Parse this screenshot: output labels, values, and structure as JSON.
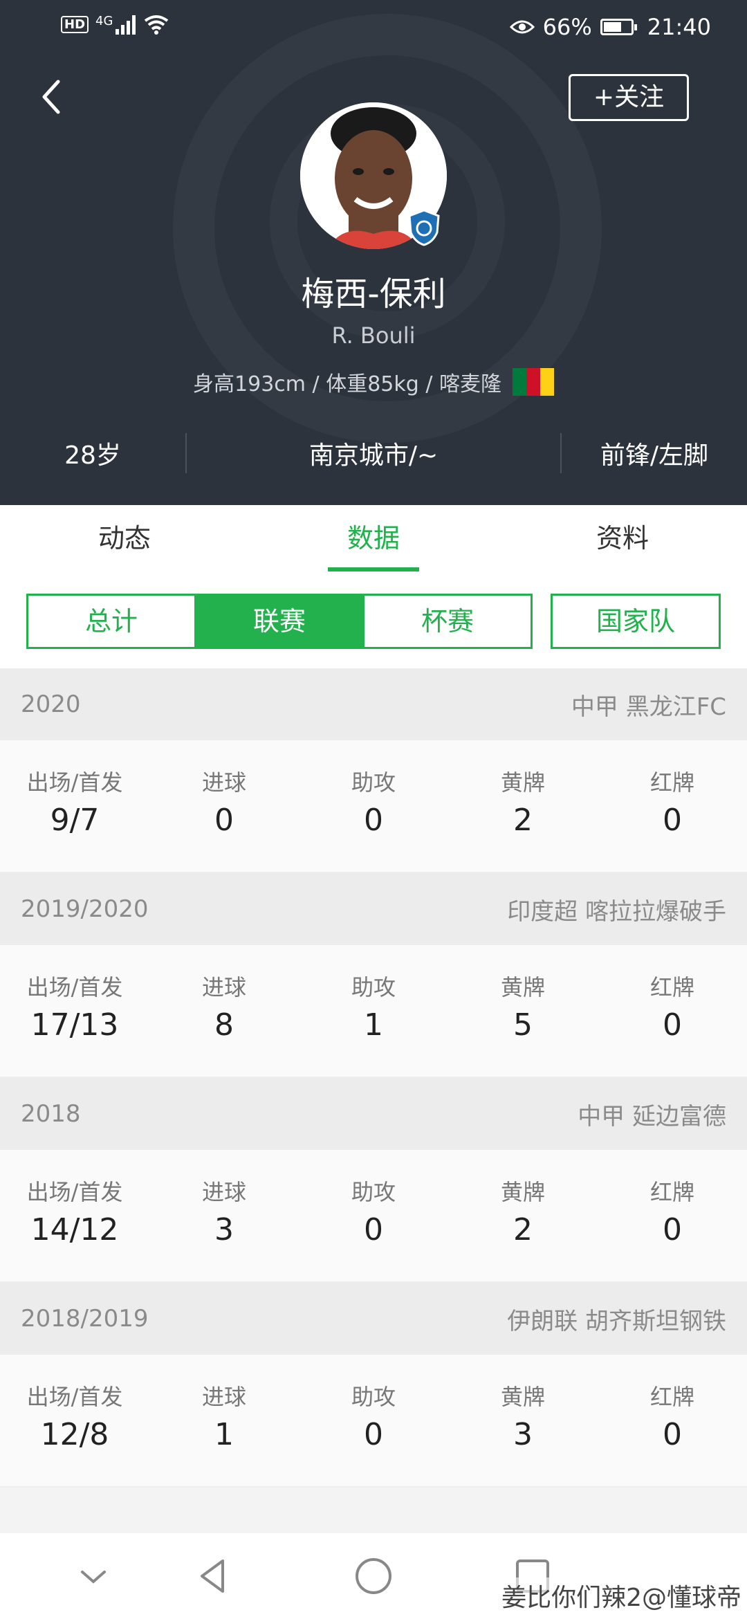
{
  "statusbar": {
    "hd": "HD",
    "network": "4G",
    "battery_pct": "66%",
    "battery_level": 0.66,
    "time": "21:40"
  },
  "header": {
    "follow_label": "+关注",
    "name_cn": "梅西-保利",
    "name_en": "R. Bouli",
    "meta": "身高193cm / 体重85kg / 喀麦隆",
    "flag_colors": [
      "#007a3d",
      "#ce1126",
      "#fcd116"
    ],
    "age": "28岁",
    "club": "南京城市/~",
    "position": "前锋/左脚"
  },
  "tabs": [
    "动态",
    "数据",
    "资料"
  ],
  "active_tab": 1,
  "sub_tabs": [
    "总计",
    "联赛",
    "杯赛"
  ],
  "active_sub_tab": 1,
  "national_team_label": "国家队",
  "stat_labels": [
    "出场/首发",
    "进球",
    "助攻",
    "黄牌",
    "红牌"
  ],
  "seasons": [
    {
      "year": "2020",
      "club": "中甲 黑龙江FC",
      "values": [
        "9/7",
        "0",
        "0",
        "2",
        "0"
      ]
    },
    {
      "year": "2019/2020",
      "club": "印度超 喀拉拉爆破手",
      "values": [
        "17/13",
        "8",
        "1",
        "5",
        "0"
      ]
    },
    {
      "year": "2018",
      "club": "中甲 延边富德",
      "values": [
        "14/12",
        "3",
        "0",
        "2",
        "0"
      ]
    },
    {
      "year": "2018/2019",
      "club": "伊朗联 胡齐斯坦钢铁",
      "values": [
        "12/8",
        "1",
        "0",
        "3",
        "0"
      ]
    }
  ],
  "watermark": "姜比你们辣2@懂球帝",
  "colors": {
    "accent": "#22b14c",
    "header_bg": "#2c333d"
  },
  "icons": [
    "back-arrow-icon",
    "eye-icon",
    "wifi-icon",
    "nav-down-icon",
    "nav-back-icon",
    "nav-home-icon",
    "nav-recent-icon"
  ]
}
